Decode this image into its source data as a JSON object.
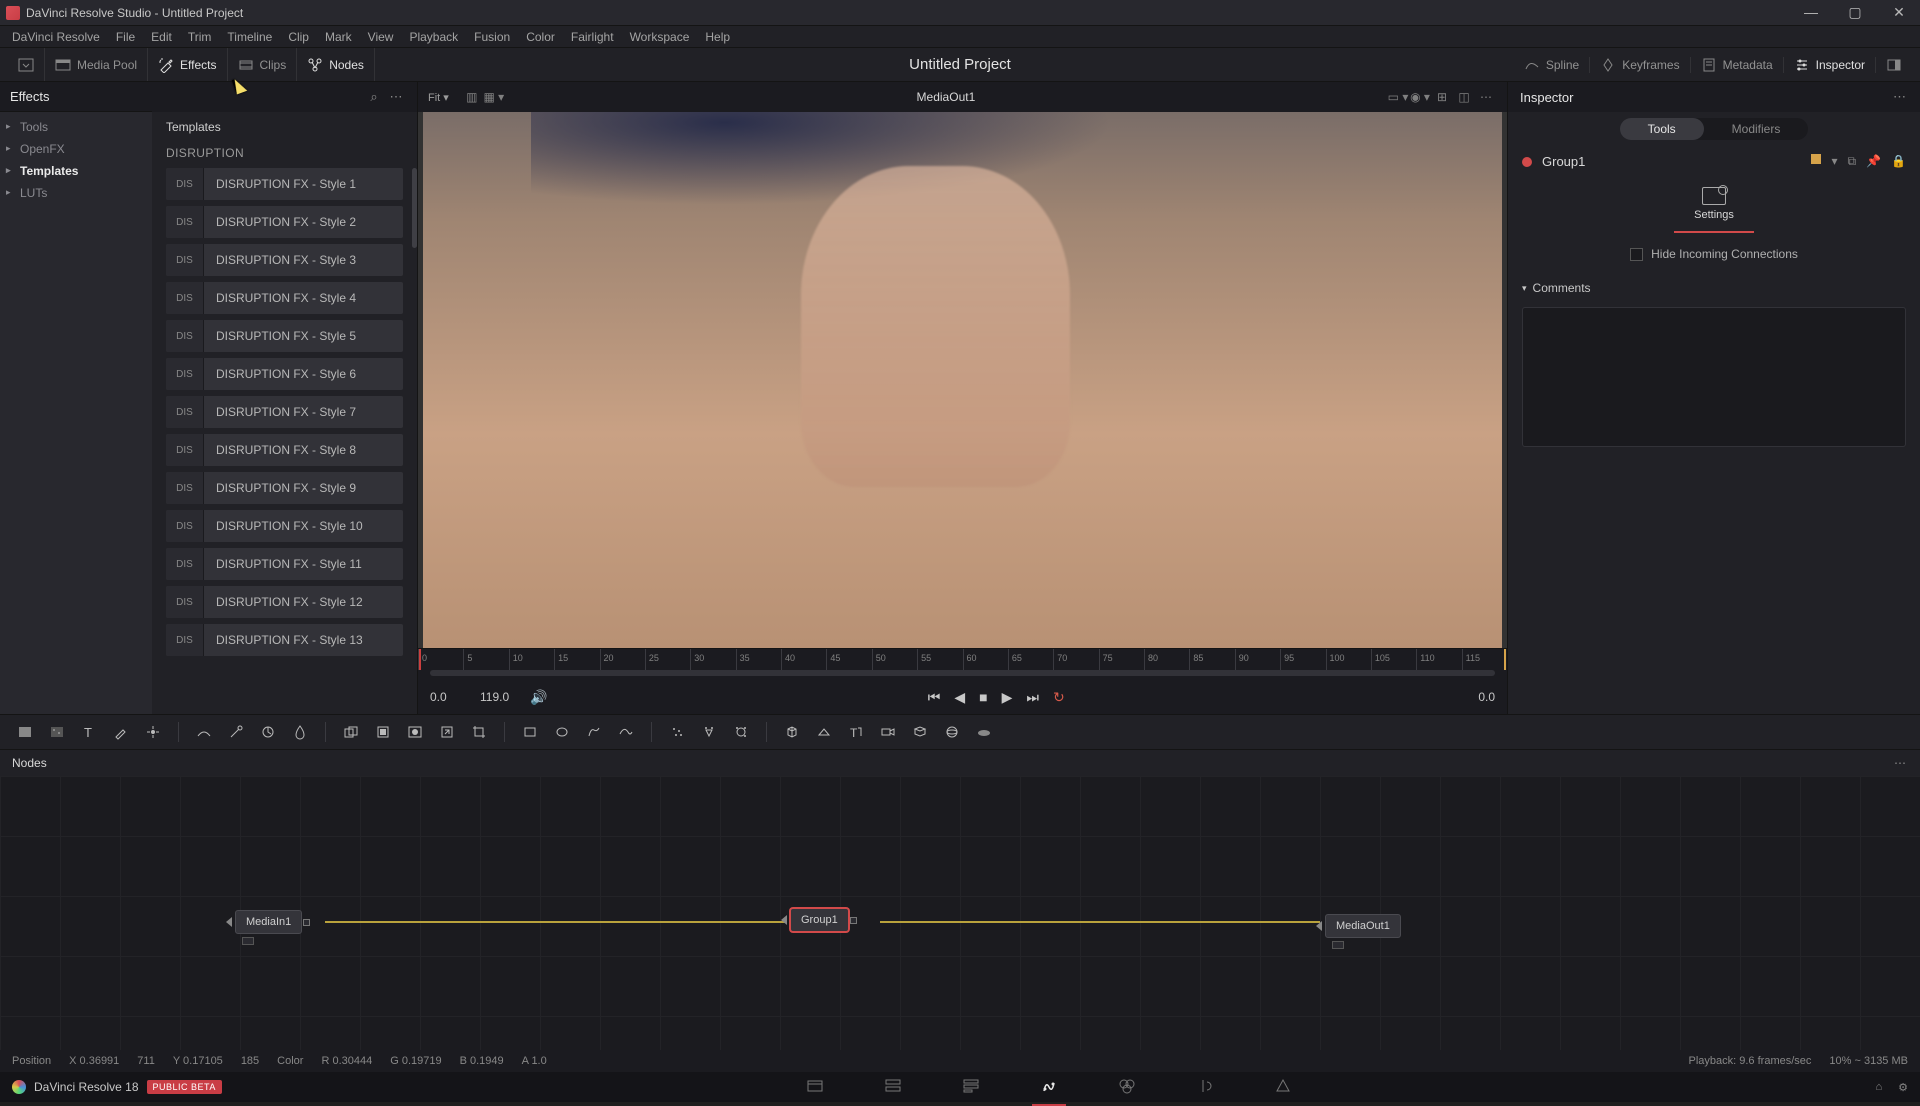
{
  "titlebar": {
    "text": "DaVinci Resolve Studio - Untitled Project"
  },
  "menu": [
    "DaVinci Resolve",
    "File",
    "Edit",
    "Trim",
    "Timeline",
    "Clip",
    "Mark",
    "View",
    "Playback",
    "Fusion",
    "Color",
    "Fairlight",
    "Workspace",
    "Help"
  ],
  "toolbar": {
    "media_pool": "Media Pool",
    "effects": "Effects",
    "clips": "Clips",
    "nodes": "Nodes",
    "project_title": "Untitled Project",
    "spline": "Spline",
    "keyframes": "Keyframes",
    "metadata": "Metadata",
    "inspector": "Inspector"
  },
  "effects_panel": {
    "title": "Effects",
    "tree": [
      "Tools",
      "OpenFX",
      "Templates",
      "LUTs"
    ],
    "tab": "Templates",
    "category": "DISRUPTION",
    "badge": "DIS",
    "items": [
      "DISRUPTION FX - Style 1",
      "DISRUPTION FX - Style 2",
      "DISRUPTION FX - Style 3",
      "DISRUPTION FX - Style 4",
      "DISRUPTION FX - Style 5",
      "DISRUPTION FX - Style 6",
      "DISRUPTION FX - Style 7",
      "DISRUPTION FX - Style 8",
      "DISRUPTION FX - Style 9",
      "DISRUPTION FX - Style 10",
      "DISRUPTION FX - Style 11",
      "DISRUPTION FX - Style 12",
      "DISRUPTION FX - Style 13"
    ]
  },
  "viewer": {
    "fit": "Fit ▾",
    "title": "MediaOut1",
    "start": "0.0",
    "total": "119.0",
    "end": "0.0",
    "ruler": [
      "0",
      "5",
      "10",
      "15",
      "20",
      "25",
      "30",
      "35",
      "40",
      "45",
      "50",
      "55",
      "60",
      "65",
      "70",
      "75",
      "80",
      "85",
      "90",
      "95",
      "100",
      "105",
      "110",
      "115"
    ]
  },
  "inspector": {
    "title": "Inspector",
    "tab_tools": "Tools",
    "tab_modifiers": "Modifiers",
    "node_name": "Group1",
    "settings": "Settings",
    "hide_incoming": "Hide Incoming Connections",
    "comments": "Comments"
  },
  "nodes_panel": {
    "title": "Nodes",
    "n1": "MediaIn1",
    "n2": "Group1",
    "n3": "MediaOut1"
  },
  "status": {
    "pos_label": "Position",
    "pos_x": "X 0.36991",
    "pos_xpx": "711",
    "pos_y": "Y 0.17105",
    "pos_ypx": "185",
    "color_label": "Color",
    "r": "R 0.30444",
    "g": "G 0.19719",
    "b": "B 0.1949",
    "a": "A 1.0",
    "playback": "Playback: 9.6 frames/sec",
    "mem": "10% ~ 3135 MB"
  },
  "bottom": {
    "app": "DaVinci Resolve 18",
    "beta": "PUBLIC BETA"
  }
}
